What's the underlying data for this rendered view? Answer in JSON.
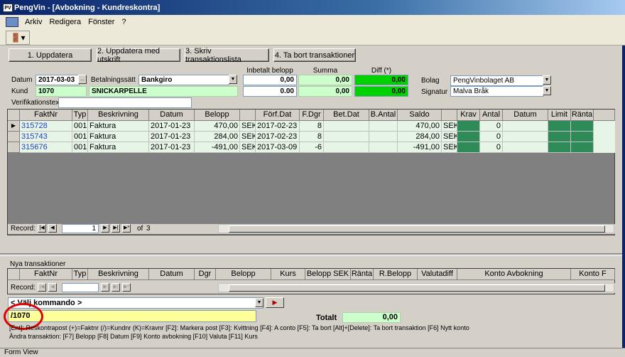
{
  "window": {
    "app_icon": "PV",
    "title": "PengVin - [Avbokning - Kundreskontra]"
  },
  "menu": [
    {
      "label": "Arkiv"
    },
    {
      "label": "Redigera"
    },
    {
      "label": "Fönster"
    },
    {
      "label": "?"
    }
  ],
  "toolbar": {
    "exit_icon": "exit-door-icon"
  },
  "actions": {
    "update": "1. Uppdatera",
    "update_print": "2. Uppdatera med utskrift",
    "print_list": "3. Skriv transaktionslista",
    "delete": "4. Ta bort transaktioner"
  },
  "form": {
    "datum_label": "Datum",
    "datum_value": "2017-03-03",
    "datum_btn": "...",
    "betalningssatt_label": "Betalningssätt",
    "betalningssatt_value": "Bankgiro",
    "kund_label": "Kund",
    "kund_id": "1070",
    "kund_name": "SNICKARPELLE",
    "verifikation_label": "Verifikationstext",
    "verifikation_value": "",
    "inbetalt_label": "Inbetalt belopp",
    "summa_label": "Summa",
    "diff_label": "Diff (*)",
    "inbetalt_1": "0,00",
    "summa_1": "0,00",
    "diff_1": "0,00",
    "inbetalt_2": "0.00",
    "summa_2": "0,00",
    "diff_2": "0,00",
    "bolag_label": "Bolag",
    "bolag_value": "PengVinbolaget AB",
    "signatur_label": "Signatur",
    "signatur_value": "Malva Bråk"
  },
  "grid": {
    "headers": [
      "FaktNr",
      "Typ",
      "Beskrivning",
      "Datum",
      "Belopp",
      "",
      "Förf.Dat",
      "F.Dgr",
      "Bet.Dat",
      "B.Antal",
      "Saldo",
      "",
      "Krav",
      "Antal",
      "Datum",
      "Limit",
      "Ränta"
    ],
    "rows": [
      {
        "faktnr": "315728",
        "typ": "001",
        "beskrivning": "Faktura",
        "datum": "2017-01-23",
        "belopp": "470,00",
        "valuta": "SEK",
        "forfdat": "2017-02-23",
        "fdgr": "8",
        "betdat": "",
        "bantal": "",
        "saldo": "470,00",
        "valuta2": "SEK",
        "antal": "0"
      },
      {
        "faktnr": "315743",
        "typ": "001",
        "beskrivning": "Faktura",
        "datum": "2017-01-23",
        "belopp": "284,00",
        "valuta": "SEK",
        "forfdat": "2017-02-23",
        "fdgr": "8",
        "betdat": "",
        "bantal": "",
        "saldo": "284,00",
        "valuta2": "SEK",
        "antal": "0"
      },
      {
        "faktnr": "315676",
        "typ": "001",
        "beskrivning": "Faktura",
        "datum": "2017-01-23",
        "belopp": "-491,00",
        "valuta": "SEK",
        "forfdat": "2017-03-09",
        "fdgr": "-6",
        "betdat": "",
        "bantal": "",
        "saldo": "-491,00",
        "valuta2": "SEK",
        "antal": "0"
      }
    ],
    "record_label": "Record:",
    "record_current": "1",
    "record_of": "of",
    "record_total": "3"
  },
  "new_transactions": {
    "title": "Nya transaktioner",
    "headers": [
      "FaktNr",
      "Typ",
      "Beskrivning",
      "Datum",
      "Dgr",
      "Belopp",
      "Kurs",
      "Belopp SEK",
      "Ränta",
      "R.Belopp",
      "Valutadiff",
      "Konto Avbokning",
      "Konto F"
    ],
    "record_label": "Record:"
  },
  "command": {
    "select_placeholder": "< Välj kommando >",
    "input_value": "/1070",
    "totalt_label": "Totalt",
    "totalt_value": "0,00",
    "help_line1": "[Ent]: Reskontrapost (+)=Faktnr (/)=Kundnr (K)=Kravnr [F2]: Markera post   [F3]: Kvittning  [F4]: A conto   [F5]: Ta bort   [Alt]+[Delete]: Ta bort transaktion   [F6] Nytt konto",
    "help_line2": "Ändra transaktion:  [F7] Belopp  [F8] Datum  [F9] Konto avbokning  [F10] Valuta  [F11] Kurs"
  },
  "status": {
    "text": "Form View"
  },
  "colors": {
    "green_cell": "#2e8b57",
    "row_bg": "#e6f5e6",
    "diff_green": "#00d200",
    "highlight": "#e00000"
  }
}
